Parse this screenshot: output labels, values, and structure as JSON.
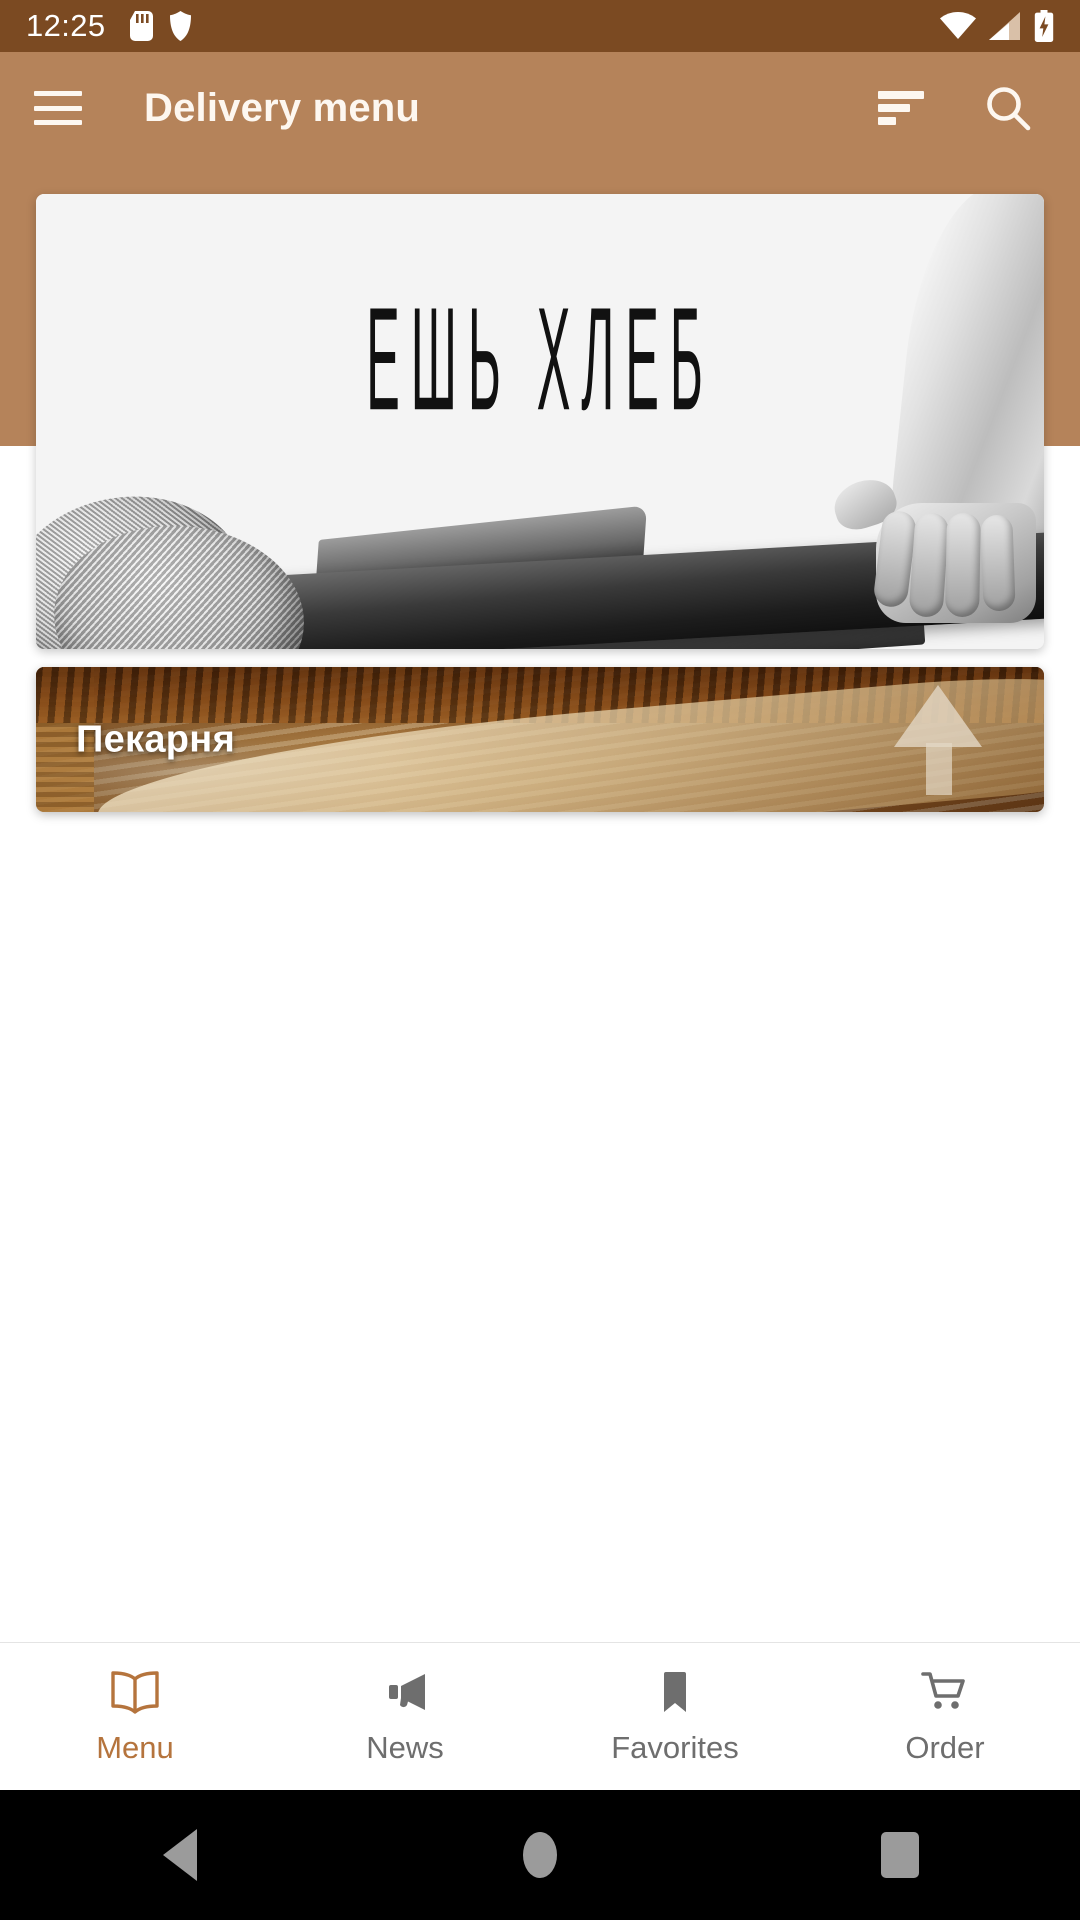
{
  "status_bar": {
    "time": "12:25",
    "icons_left": [
      "sd-card-icon",
      "shield-icon"
    ],
    "icons_right": [
      "wifi-icon",
      "cellular-signal-icon",
      "battery-charging-icon"
    ],
    "background_color": "#7b4a22"
  },
  "app_bar": {
    "menu_icon": "hamburger-menu-icon",
    "title": "Delivery menu",
    "sort_icon": "sort-icon",
    "search_icon": "search-icon",
    "background_color": "#b5835a",
    "text_color": "#fdf7f0"
  },
  "hero_banner": {
    "headline": "ЕШЬ ХЛЕБ",
    "description": "Black and white photo of rustic bread loaves, a baker's blade and a hand holding a dark baguette on a light background",
    "background_color": "#f4f4f4"
  },
  "category_cards": [
    {
      "label": "Пекарня",
      "description": "Warm brown photo of sliced bread on a wooden board"
    }
  ],
  "bottom_nav": {
    "active_index": 0,
    "active_color": "#b5743d",
    "inactive_color": "#6e6e6e",
    "items": [
      {
        "label": "Menu",
        "icon": "open-book-icon"
      },
      {
        "label": "News",
        "icon": "megaphone-icon"
      },
      {
        "label": "Favorites",
        "icon": "bookmark-icon"
      },
      {
        "label": "Order",
        "icon": "shopping-cart-icon"
      }
    ]
  },
  "system_nav": {
    "background_color": "#000000",
    "buttons": [
      {
        "name": "back-button",
        "icon": "triangle-back-icon"
      },
      {
        "name": "home-button",
        "icon": "circle-home-icon"
      },
      {
        "name": "recents-button",
        "icon": "square-recents-icon"
      }
    ]
  }
}
